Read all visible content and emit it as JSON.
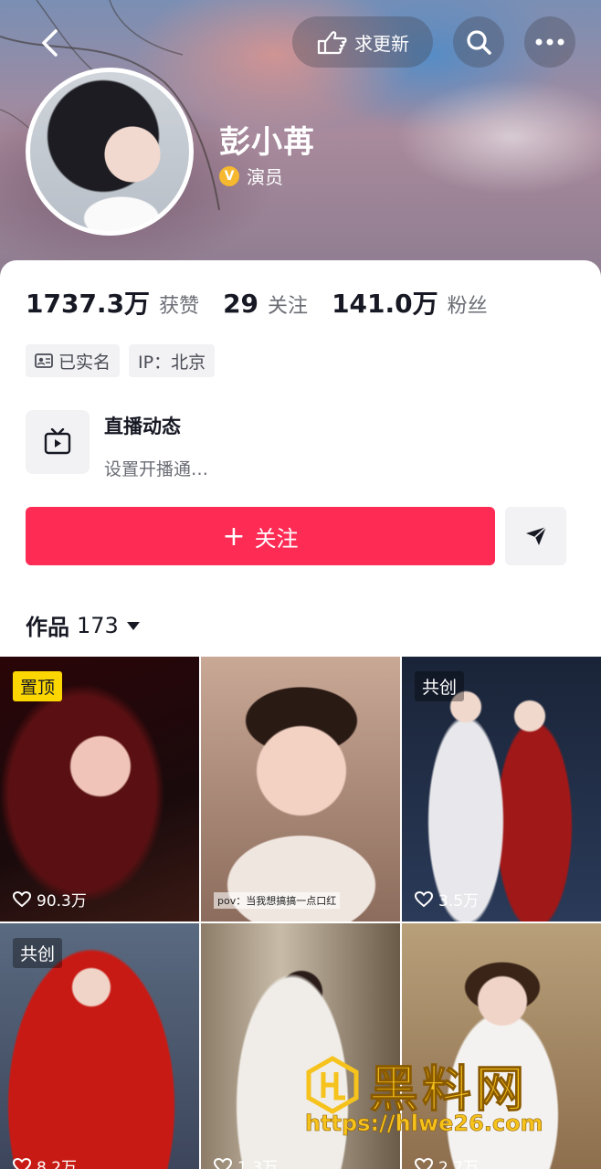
{
  "header": {
    "update_label": "求更新",
    "icons": [
      "back-icon",
      "pointing-hand-icon",
      "search-icon",
      "more-icon"
    ]
  },
  "profile": {
    "name": "彭小苒",
    "verified_label": "演员",
    "verified_badge": "V"
  },
  "stats": [
    {
      "value": "1737.3万",
      "label": "获赞"
    },
    {
      "value": "29",
      "label": "关注"
    },
    {
      "value": "141.0万",
      "label": "粉丝"
    }
  ],
  "tags": [
    {
      "icon": "id-card-icon",
      "label": "已实名"
    },
    {
      "label": "IP：北京"
    }
  ],
  "live": {
    "title": "直播动态",
    "subtitle": "设置开播通…"
  },
  "actions": {
    "follow_label": "关注",
    "follow_plus": "+",
    "accent_color": "#fe2c55"
  },
  "works": {
    "label": "作品",
    "count": "173"
  },
  "grid": [
    {
      "badge": "置顶",
      "badge_type": "pin",
      "likes": "90.3万",
      "caption": ""
    },
    {
      "badge": "",
      "badge_type": "",
      "likes": "",
      "caption": "pov：当我想搞搞一点口红"
    },
    {
      "badge": "共创",
      "badge_type": "co",
      "likes": "3.5万",
      "caption": ""
    },
    {
      "badge": "共创",
      "badge_type": "co",
      "likes": "8.2万",
      "caption": ""
    },
    {
      "badge": "",
      "badge_type": "",
      "likes": "1.3万",
      "caption": ""
    },
    {
      "badge": "",
      "badge_type": "",
      "likes": "2.7万",
      "caption": ""
    }
  ],
  "watermark": {
    "title": "黑料网",
    "url": "https://hlwe26.com"
  }
}
